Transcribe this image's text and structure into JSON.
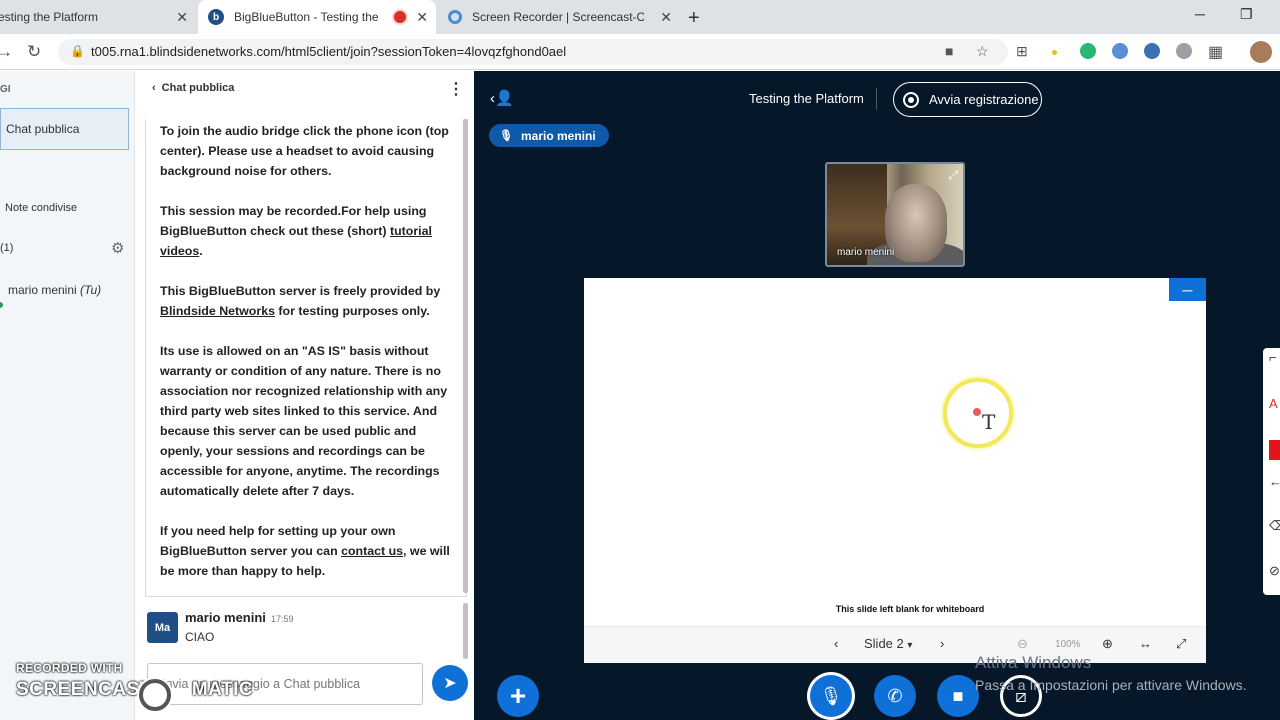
{
  "browser": {
    "tabs": [
      {
        "title": "esting the Platform"
      },
      {
        "title": "BigBlueButton - Testing the P"
      },
      {
        "title": "Screen Recorder | Screencast-O-M"
      }
    ],
    "url": "t005.rna1.blindsidenetworks.com/html5client/join?sessionToken=4lovqzfghond0ael"
  },
  "user_panel": {
    "header": "GI",
    "chat_item": "Chat pubblica",
    "notes_item": "Note condivise",
    "users_count": "(1)",
    "user_name": "mario menini",
    "user_self": "(Tu)"
  },
  "chat": {
    "header": "Chat pubblica",
    "welcome": {
      "p1": "To join the audio bridge click the phone icon (top center). Please use a headset to avoid causing background noise for others.",
      "p2_a": "This session may be recorded.For help using BigBlueButton check out these (short) ",
      "p2_link": "tutorial videos",
      "p2_b": ".",
      "p3_a": "This BigBlueButton server is freely provided by ",
      "p3_link": "Blindside Networks",
      "p3_b": " for testing purposes only.",
      "p4": "Its use is allowed on an \"AS IS\" basis without warranty or condition of any nature. There is no association nor recognized relationship with any third party web sites linked to this service. And because this server can be used public and openly, your sessions and recordings can be accessible for anyone, anytime. The recordings automatically delete after 7 days.",
      "p5_a": "If you need help for setting up your own BigBlueButton server you can ",
      "p5_link": "contact us",
      "p5_b": ", we will be more than happy to help."
    },
    "message": {
      "avatar": "Ma",
      "name": "mario menini",
      "time": "17:59",
      "text": "CIAO"
    },
    "input_placeholder": "Invia un messaggio a Chat pubblica"
  },
  "watermark": {
    "line1": "RECORDED WITH",
    "line2_a": "SCREENCAST",
    "line2_b": "MATIC"
  },
  "meeting": {
    "title": "Testing the Platform",
    "record_label": "Avvia registrazione",
    "talker": "mario menini",
    "webcam_name": "mario menini"
  },
  "presentation": {
    "caption": "This slide left blank for whiteboard",
    "slide_label": "Slide 2",
    "zoom": "100%"
  },
  "windows_notice": {
    "line1": "Attiva Windows",
    "line2": "Passa a Impostazioni per attivare Windows."
  },
  "colors": {
    "accent": "#0f70d7",
    "dark_bg": "#06172a"
  }
}
